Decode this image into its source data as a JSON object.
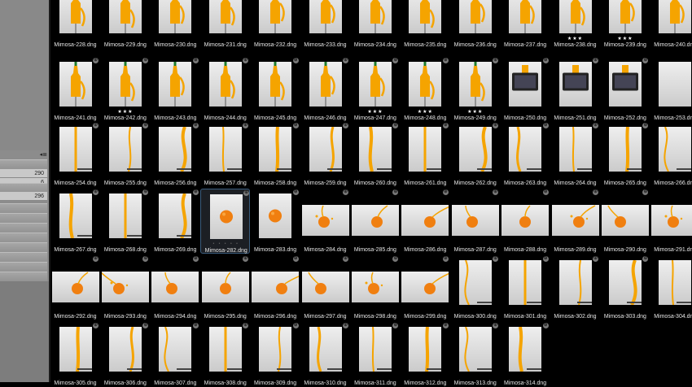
{
  "sidebar": {
    "collapse_glyph": "◂≣",
    "fields": [
      "290",
      "6",
      "296"
    ]
  },
  "grid": {
    "prefix": "Mimosa-",
    "extension": ".dng",
    "selected": "Mimosa-282.dng",
    "rows": [
      {
        "files": [
          "Mimosa-228.dng",
          "Mimosa-229.dng",
          "Mimosa-230.dng",
          "Mimosa-231.dng",
          "Mimosa-232.dng",
          "Mimosa-233.dng",
          "Mimosa-234.dng",
          "Mimosa-235.dng",
          "Mimosa-236.dng",
          "Mimosa-237.dng",
          "Mimosa-238.dng",
          "Mimosa-239.dng",
          "Mimosa-240.dng"
        ],
        "ratings": {
          "Mimosa-238.dng": "★★★",
          "Mimosa-239.dng": "★★★"
        }
      },
      {
        "files": [
          "Mimosa-241.dng",
          "Mimosa-242.dng",
          "Mimosa-243.dng",
          "Mimosa-244.dng",
          "Mimosa-245.dng",
          "Mimosa-246.dng",
          "Mimosa-247.dng",
          "Mimosa-248.dng",
          "Mimosa-249.dng",
          "Mimosa-250.dng",
          "Mimosa-251.dng",
          "Mimosa-252.dng",
          "Mimosa-253.dng"
        ],
        "ratings": {
          "Mimosa-242.dng": "★★★",
          "Mimosa-247.dng": "★★★",
          "Mimosa-248.dng": "★★★",
          "Mimosa-249.dng": "★★★"
        }
      },
      {
        "files": [
          "Mimosa-254.dng",
          "Mimosa-255.dng",
          "Mimosa-256.dng",
          "Mimosa-257.dng",
          "Mimosa-258.dng",
          "Mimosa-259.dng",
          "Mimosa-260.dng",
          "Mimosa-261.dng",
          "Mimosa-262.dng",
          "Mimosa-263.dng",
          "Mimosa-264.dng",
          "Mimosa-265.dng",
          "Mimosa-266.dng"
        ],
        "ratings": {}
      },
      {
        "files": [
          "Mimosa-267.dng",
          "Mimosa-268.dng",
          "Mimosa-269.dng",
          "Mimosa-282.dng",
          "Mimosa-283.dng",
          "Mimosa-284.dng",
          "Mimosa-285.dng",
          "Mimosa-286.dng",
          "Mimosa-287.dng",
          "Mimosa-288.dng",
          "Mimosa-289.dng",
          "Mimosa-290.dng",
          "Mimosa-291.dng"
        ],
        "ratings": {}
      },
      {
        "files": [
          "Mimosa-292.dng",
          "Mimosa-293.dng",
          "Mimosa-294.dng",
          "Mimosa-295.dng",
          "Mimosa-296.dng",
          "Mimosa-297.dng",
          "Mimosa-298.dng",
          "Mimosa-299.dng",
          "Mimosa-300.dng",
          "Mimosa-301.dng",
          "Mimosa-302.dng",
          "Mimosa-303.dng",
          "Mimosa-304.dng"
        ],
        "ratings": {}
      },
      {
        "files": [
          "Mimosa-305.dng",
          "Mimosa-306.dng",
          "Mimosa-307.dng",
          "Mimosa-308.dng",
          "Mimosa-309.dng",
          "Mimosa-310.dng",
          "Mimosa-311.dng",
          "Mimosa-312.dng",
          "Mimosa-313.dng",
          "Mimosa-314.dng"
        ],
        "ratings": {}
      }
    ]
  },
  "thumbnail_kinds": {
    "bottle": [
      "Mimosa-228.dng",
      "Mimosa-229.dng",
      "Mimosa-230.dng",
      "Mimosa-231.dng",
      "Mimosa-232.dng",
      "Mimosa-233.dng",
      "Mimosa-234.dng",
      "Mimosa-235.dng",
      "Mimosa-236.dng",
      "Mimosa-237.dng",
      "Mimosa-238.dng",
      "Mimosa-239.dng",
      "Mimosa-240.dng",
      "Mimosa-241.dng",
      "Mimosa-242.dng",
      "Mimosa-243.dng",
      "Mimosa-244.dng",
      "Mimosa-245.dng",
      "Mimosa-246.dng",
      "Mimosa-247.dng",
      "Mimosa-248.dng",
      "Mimosa-249.dng"
    ],
    "phone": [
      "Mimosa-250.dng",
      "Mimosa-251.dng",
      "Mimosa-252.dng"
    ],
    "empty": [
      "Mimosa-253.dng"
    ],
    "orange": [
      "Mimosa-282.dng",
      "Mimosa-283.dng"
    ],
    "orange_landscape": [
      "Mimosa-284.dng",
      "Mimosa-285.dng",
      "Mimosa-286.dng",
      "Mimosa-287.dng",
      "Mimosa-288.dng",
      "Mimosa-289.dng",
      "Mimosa-290.dng",
      "Mimosa-291.dng",
      "Mimosa-292.dng",
      "Mimosa-293.dng",
      "Mimosa-294.dng",
      "Mimosa-295.dng",
      "Mimosa-296.dng",
      "Mimosa-297.dng",
      "Mimosa-298.dng",
      "Mimosa-299.dng"
    ],
    "stream": "default"
  },
  "colors": {
    "background": "#000000",
    "label": "#e6e6e6",
    "selection_border": "#3b5d7e",
    "selection_fill": "#1c1f24",
    "juice": "#f5a400",
    "orange": "#f07f10",
    "backdrop": "#e6e6e6",
    "sidebar": "#8c8c8c"
  }
}
